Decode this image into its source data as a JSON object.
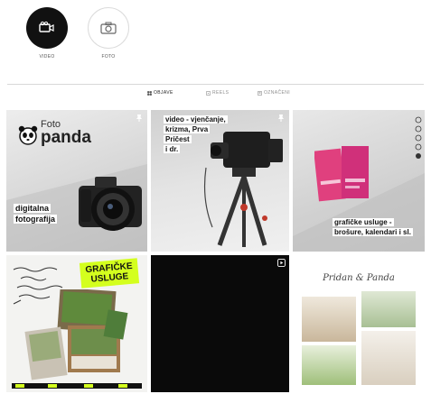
{
  "highlights": [
    {
      "label": "VIDEO",
      "icon": "video-camera-icon",
      "style": "dark"
    },
    {
      "label": "FOTO",
      "icon": "camera-icon",
      "style": "light"
    }
  ],
  "tabs": [
    {
      "label": "OBJAVE",
      "icon": "grid-icon",
      "active": true
    },
    {
      "label": "REELS",
      "icon": "reels-icon",
      "active": false
    },
    {
      "label": "OZNAČENI",
      "icon": "tagged-icon",
      "active": false
    }
  ],
  "posts": {
    "p1": {
      "logo_small": "Foto",
      "logo_big": "panda",
      "caption_line1": "digitalna",
      "caption_line2": "fotografija"
    },
    "p2": {
      "line1": "video - vjenčanje,",
      "line2": "krizma, Prva",
      "line3": "Pričest",
      "line4": "i dr."
    },
    "p3": {
      "line1": "grafičke usluge -",
      "line2": "brošure, kalendari i sl."
    },
    "p4": {
      "badge_line1": "GRAFIČKE",
      "badge_line2": "USLUGE"
    },
    "p6": {
      "script_text": "Pridan & Panda"
    }
  },
  "colors": {
    "highlight_dark": "#111111",
    "accent_yellow": "#d4ff1e",
    "flyer_pink": "#e0407e",
    "tab_active": "#262626",
    "tab_inactive": "#8e8e8e"
  }
}
